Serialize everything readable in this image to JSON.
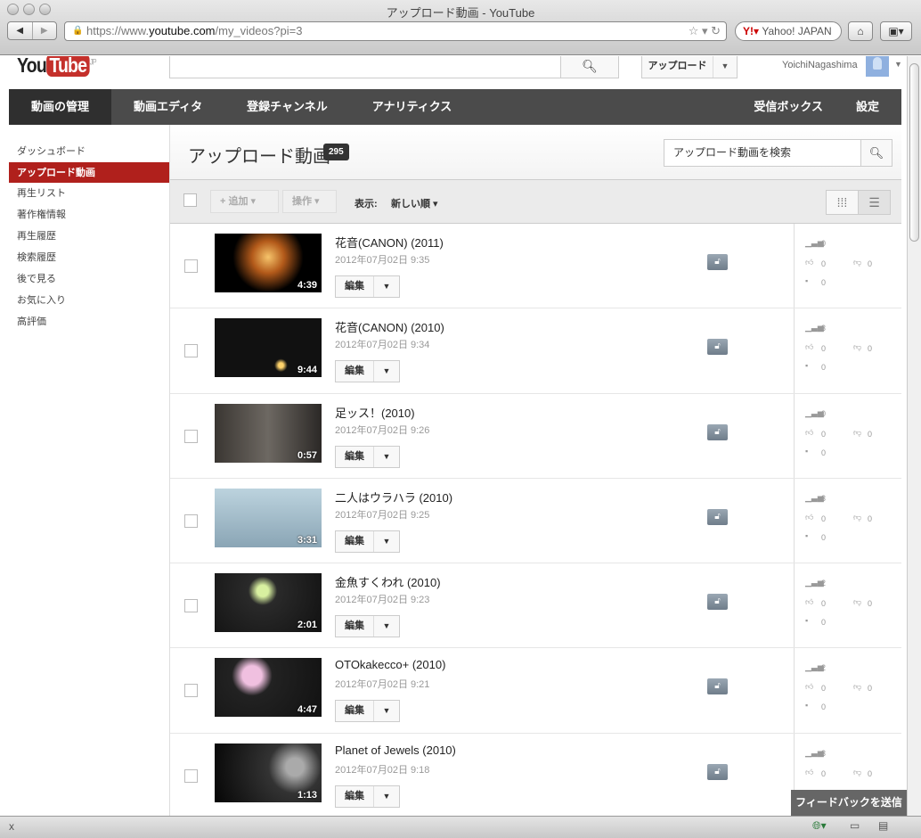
{
  "browser": {
    "window_title": "アップロード動画 - YouTube",
    "url_prefix": "https://www.",
    "url_domain": "youtube.com",
    "url_path": "/my_videos?pi=3",
    "search_engine": "Yahoo! JAPAN",
    "status_close": "x"
  },
  "header": {
    "logo_you": "You",
    "logo_tube": "Tube",
    "logo_region": "JP",
    "search_placeholder": "",
    "upload_label": "アップロード",
    "username": "YoichiNagashima"
  },
  "nav": {
    "items": [
      "動画の管理",
      "動画エディタ",
      "登録チャンネル",
      "アナリティクス"
    ],
    "right_items": [
      "受信ボックス",
      "設定"
    ]
  },
  "sidebar": {
    "items": [
      "ダッシュボード",
      "アップロード動画",
      "再生リスト",
      "著作権情報",
      "再生履歴",
      "検索履歴",
      "後で見る",
      "お気に入り",
      "高評価"
    ],
    "active_index": 1
  },
  "main": {
    "title": "アップロード動画",
    "count": "295",
    "search_placeholder": "アップロード動画を検索",
    "toolbar": {
      "add_label": "+ 追加",
      "actions_label": "操作",
      "view_label": "表示:",
      "sort_label": "新しい順"
    },
    "edit_label": "編集",
    "videos": [
      {
        "title": "花音(CANON) (2011)",
        "date": "2012年07月02日 9:35",
        "duration": "4:39",
        "views": "0",
        "likes": "0",
        "dislikes": "0",
        "comments": "0"
      },
      {
        "title": "花音(CANON) (2010)",
        "date": "2012年07月02日 9:34",
        "duration": "9:44",
        "views": "3",
        "likes": "0",
        "dislikes": "0",
        "comments": "0"
      },
      {
        "title": "足ッス！(2010)",
        "date": "2012年07月02日 9:26",
        "duration": "0:57",
        "views": "0",
        "likes": "0",
        "dislikes": "0",
        "comments": "0"
      },
      {
        "title": "二人はウラハラ (2010)",
        "date": "2012年07月02日 9:25",
        "duration": "3:31",
        "views": "3",
        "likes": "0",
        "dislikes": "0",
        "comments": "0"
      },
      {
        "title": "金魚すくわれ (2010)",
        "date": "2012年07月02日 9:23",
        "duration": "2:01",
        "views": "2",
        "likes": "0",
        "dislikes": "0",
        "comments": "0"
      },
      {
        "title": "OTOkakecco+ (2010)",
        "date": "2012年07月02日 9:21",
        "duration": "4:47",
        "views": "2",
        "likes": "0",
        "dislikes": "0",
        "comments": "0"
      },
      {
        "title": "Planet of Jewels (2010)",
        "date": "2012年07月02日 9:18",
        "duration": "1:13",
        "views": "3",
        "likes": "0",
        "dislikes": "0",
        "comments": ""
      }
    ]
  },
  "feedback_label": "フィードバックを送信",
  "colors": {
    "accent": "#b0201c",
    "nav_bg": "#4b4b4b"
  }
}
